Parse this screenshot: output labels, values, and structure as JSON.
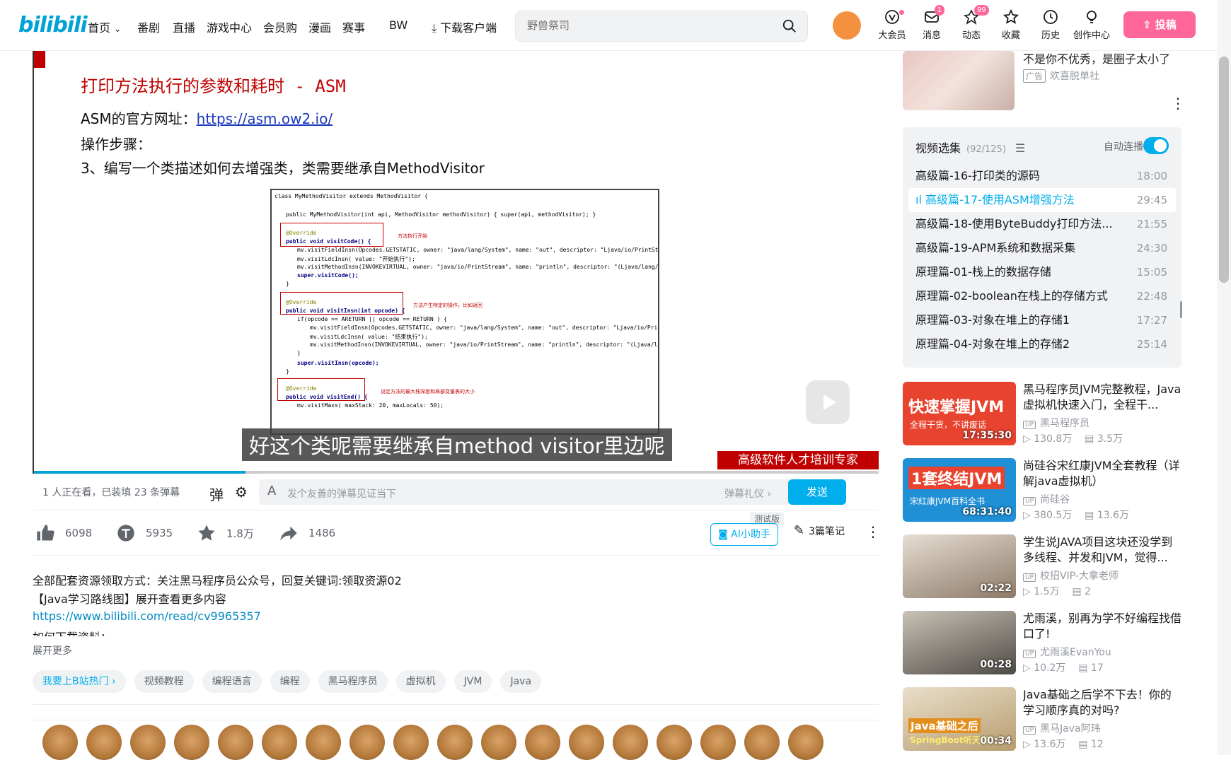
{
  "header": {
    "logo": "bilibili",
    "nav": [
      "首页",
      "番剧",
      "直播",
      "游戏中心",
      "会员购",
      "漫画",
      "赛事",
      "BW",
      "下载客户端"
    ],
    "search_placeholder": "野兽祭司",
    "icons": [
      {
        "label": "大会员",
        "icon": "vip-icon",
        "badge": ""
      },
      {
        "label": "消息",
        "icon": "message-icon",
        "badge": "1"
      },
      {
        "label": "动态",
        "icon": "dynamic-icon",
        "badge": "99"
      },
      {
        "label": "收藏",
        "icon": "star-icon",
        "badge": ""
      },
      {
        "label": "历史",
        "icon": "clock-icon",
        "badge": ""
      },
      {
        "label": "创作中心",
        "icon": "bulb-icon",
        "badge": ""
      }
    ],
    "upload": "投稿"
  },
  "player": {
    "slide_title": "打印方法执行的参数和耗时 - ASM",
    "slide_lines": [
      "ASM的官方网址：",
      "操作步骤：",
      "3、编写一个类描述如何去增强类，类需要继承自MethodVisitor"
    ],
    "slide_link": "https://asm.ow2.io/",
    "code_lines": [
      "class MyMethodVisitor extends MethodVisitor {",
      "public MyMethodVisitor(int api, MethodVisitor methodVisitor) { super(api, methodVisitor); }",
      "@Override",
      "public void visitCode() {",
      "mv.visitFieldInsn(Opcodes.GETSTATIC, owner: \"java/lang/System\", name: \"out\", descriptor: \"Ljava/io/PrintStre",
      "mv.visitLdcInsn( value: \"开始执行\");",
      "mv.visitMethodInsn(INVOKEVIRTUAL, owner: \"java/io/PrintStream\", name: \"println\", descriptor: \"(Ljava/lang/St",
      "super.visitCode();",
      "}",
      "@Override",
      "public void visitInsn(int opcode) {",
      "if(opcode == ARETURN || opcode == RETURN ) {",
      "mv.visitFieldInsn(Opcodes.GETSTATIC, owner: \"java/lang/System\", name: \"out\", descriptor: \"Ljava/io/Prin",
      "mv.visitLdcInsn( value: \"结束执行\");",
      "mv.visitMethodInsn(INVOKEVIRTUAL, owner: \"java/io/PrintStream\", name: \"println\", descriptor: \"(Ljava/la",
      "}",
      "super.visitInsn(opcode);",
      "}",
      "@Override",
      "public void visitEnd() {",
      "mv.visitMaxs( maxStack: 20, maxLocals: 50);"
    ],
    "notes": [
      "方法执行开始",
      "方法产生特定的操作，比如返回",
      "设定方法的最大栈深度和局部变量表的大小"
    ],
    "subtitle": "好这个类呢需要继承自method visitor里边呢",
    "brand": "高级软件人才培训专家"
  },
  "danmaku": {
    "status": "1 人正在看，已装填 23 条弹幕",
    "placeholder": "发个友善的弹幕见证当下",
    "gift": "弹幕礼仪 ›",
    "send": "发送"
  },
  "toolbar": {
    "like": "6098",
    "coin": "5935",
    "fav": "1.8万",
    "share": "1486",
    "ai": "AI小助手",
    "beta": "测试版",
    "notes": "3篇笔记"
  },
  "description": {
    "line1": "全部配套资源领取方式：关注黑马程序员公众号，回复关键词:领取资源02",
    "line2": "【Java学习路线图】展开查看更多内容",
    "link": "https://www.bilibili.com/read/cv9965357",
    "line3": "如何下载资料：",
    "expand": "展开更多"
  },
  "tags": [
    "我要上B站热门 ›",
    "视频教程",
    "编程语言",
    "编程",
    "黑马程序员",
    "虚拟机",
    "JVM",
    "Java"
  ],
  "ad": {
    "title": "不是你不优秀，是圈子太小了",
    "tag": "广告",
    "source": "欢喜脱单社"
  },
  "playlist": {
    "title": "视频选集",
    "count": "(92/125)",
    "auto": "自动连播",
    "items": [
      {
        "title": "高级篇-16-打印类的源码",
        "dur": "18:00"
      },
      {
        "title": "高级篇-17-使用ASM增强方法",
        "dur": "29:45"
      },
      {
        "title": "高级篇-18-使用ByteBuddy打印方法...",
        "dur": "21:55"
      },
      {
        "title": "高级篇-19-APM系统和数据采集",
        "dur": "24:30"
      },
      {
        "title": "原理篇-01-栈上的数据存储",
        "dur": "15:05"
      },
      {
        "title": "原理篇-02-boolean在栈上的存储方式",
        "dur": "22:48"
      },
      {
        "title": "原理篇-03-对象在堆上的存储1",
        "dur": "17:27"
      },
      {
        "title": "原理篇-04-对象在堆上的存储2",
        "dur": "25:14"
      }
    ]
  },
  "recommend": [
    {
      "title": "黑马程序员JVM完整教程，Java虚拟机快速入门，全程干...",
      "up": "黑马程序员",
      "plays": "130.8万",
      "danmaku": "3.5万",
      "dur": "17:35:30",
      "big": "快速掌握JVM",
      "small": "全程干货，不讲废话",
      "bg": "#e8432f"
    },
    {
      "title": "尚硅谷宋红康JVM全套教程（详解java虚拟机）",
      "up": "尚硅谷",
      "plays": "380.5万",
      "danmaku": "13.6万",
      "dur": "68:31:40",
      "big": "1套终结JVM",
      "small": "宋红康JVM百科全书",
      "bg": "#1f8fd6"
    },
    {
      "title": "学生说JAVA项目这块还没学到多线程、并发和JVM，觉得...",
      "up": "校招VIP-大拿老师",
      "plays": "1.5万",
      "danmaku": "2",
      "dur": "02:22",
      "big": "",
      "small": "",
      "bg": "#a89b8c"
    },
    {
      "title": "尤雨溪，别再为学不好编程找借口了!",
      "up": "尤雨溪EvanYou",
      "plays": "10.2万",
      "danmaku": "17",
      "dur": "00:28",
      "big": "",
      "small": "",
      "bg": "#6f6a64"
    },
    {
      "title": "Java基础之后学不下去！你的学习顺序真的对吗?",
      "up": "黑马Java阿玮",
      "plays": "13.6万",
      "danmaku": "12",
      "dur": "00:34",
      "big": "Java基础之后",
      "small": "SpringBoot听天书",
      "bg": "#d9c7a8"
    }
  ]
}
